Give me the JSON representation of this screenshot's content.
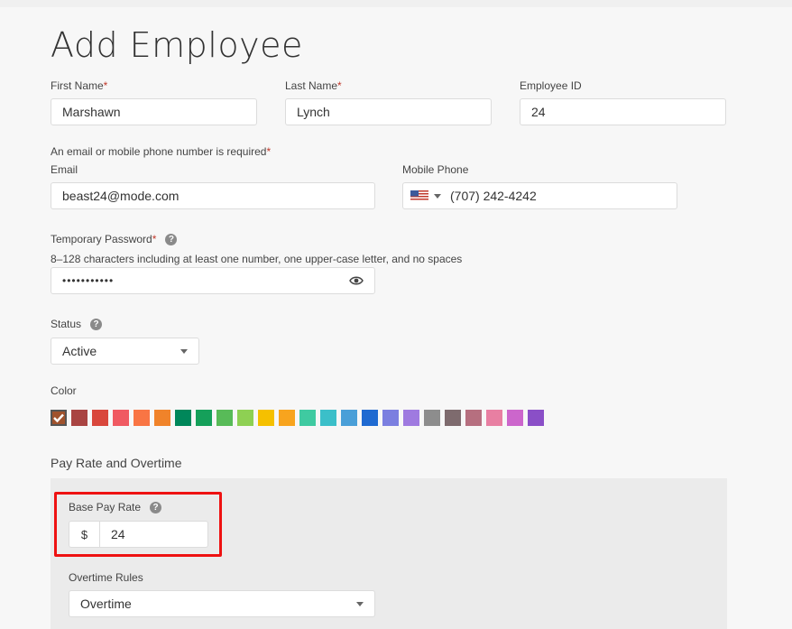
{
  "page": {
    "title": "Add Employee"
  },
  "first_name": {
    "label": "First Name",
    "required": "*",
    "value": "Marshawn"
  },
  "last_name": {
    "label": "Last Name",
    "required": "*",
    "value": "Lynch"
  },
  "employee_id": {
    "label": "Employee ID",
    "value": "24"
  },
  "contact_note": {
    "text": "An email or mobile phone number is required",
    "required": "*"
  },
  "email": {
    "label": "Email",
    "value": "beast24@mode.com"
  },
  "mobile_phone": {
    "label": "Mobile Phone",
    "value": "(707) 242-4242",
    "flag": "us-flag-icon"
  },
  "password": {
    "label": "Temporary Password",
    "required": "*",
    "hint": "8–128 characters including at least one number, one upper-case letter, and no spaces",
    "value": "•••••••••••"
  },
  "status": {
    "label": "Status",
    "value": "Active"
  },
  "color": {
    "label": "Color",
    "selected_index": 0,
    "swatches": [
      "#a0522d",
      "#a94442",
      "#d9473c",
      "#f05a62",
      "#f97544",
      "#f0832a",
      "#00875a",
      "#15a05a",
      "#58bb58",
      "#8ed053",
      "#f5c000",
      "#f8a41e",
      "#3fcaa1",
      "#3bbfc9",
      "#4a9fd8",
      "#1f6ad1",
      "#7b7fe0",
      "#9f7ae0",
      "#8d8d8d",
      "#7e6b6e",
      "#b66f7f",
      "#e87fa2",
      "#cc66cc",
      "#8a4fc7"
    ]
  },
  "pay_rate": {
    "section_title": "Pay Rate and Overtime",
    "label": "Base Pay Rate",
    "currency": "$",
    "value": "24"
  },
  "overtime": {
    "label": "Overtime Rules",
    "value": "Overtime"
  }
}
